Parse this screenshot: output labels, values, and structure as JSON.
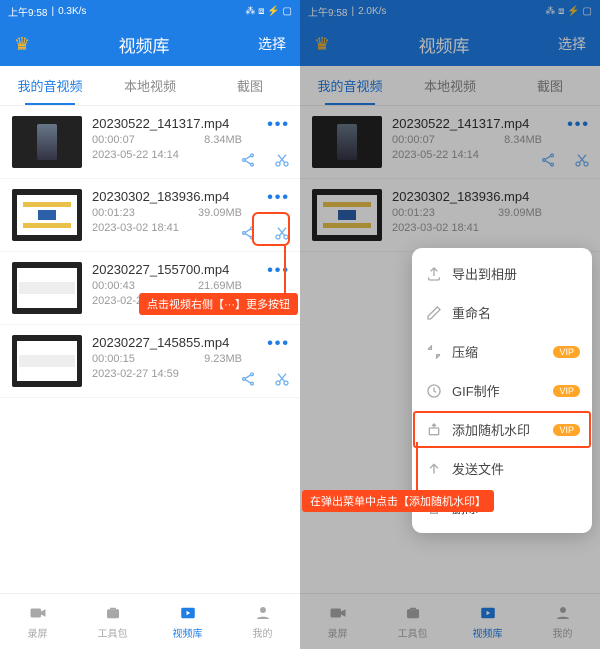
{
  "status": {
    "time": "上午9:58",
    "speed_left": "0.3K/s",
    "speed_right": "2.0K/s",
    "icons": "⁂ ⧈ ⚡ ▢"
  },
  "header": {
    "title": "视频库",
    "select": "选择"
  },
  "tabs": [
    "我的音视频",
    "本地视频",
    "截图"
  ],
  "items": [
    {
      "name": "20230522_141317.mp4",
      "dur": "00:00:07",
      "size": "8.34MB",
      "date": "2023-05-22 14:14"
    },
    {
      "name": "20230302_183936.mp4",
      "dur": "00:01:23",
      "size": "39.09MB",
      "date": "2023-03-02 18:41"
    },
    {
      "name": "20230227_155700.mp4",
      "dur": "00:00:43",
      "size": "21.69MB",
      "date": "2023-02-27 15:57"
    },
    {
      "name": "20230227_145855.mp4",
      "dur": "00:00:15",
      "size": "9.23MB",
      "date": "2023-02-27 14:59"
    }
  ],
  "nav": [
    "录屏",
    "工具包",
    "视频库",
    "我的"
  ],
  "callout1": "点击视频右侧【···】更多按钮",
  "callout2": "在弹出菜单中点击【添加随机水印】",
  "popup": [
    {
      "label": "导出到相册"
    },
    {
      "label": "重命名"
    },
    {
      "label": "压缩",
      "vip": "VIP"
    },
    {
      "label": "GIF制作",
      "vip": "VIP"
    },
    {
      "label": "添加随机水印",
      "vip": "VIP",
      "hl": true
    },
    {
      "label": "发送文件"
    },
    {
      "label": "删除"
    }
  ]
}
